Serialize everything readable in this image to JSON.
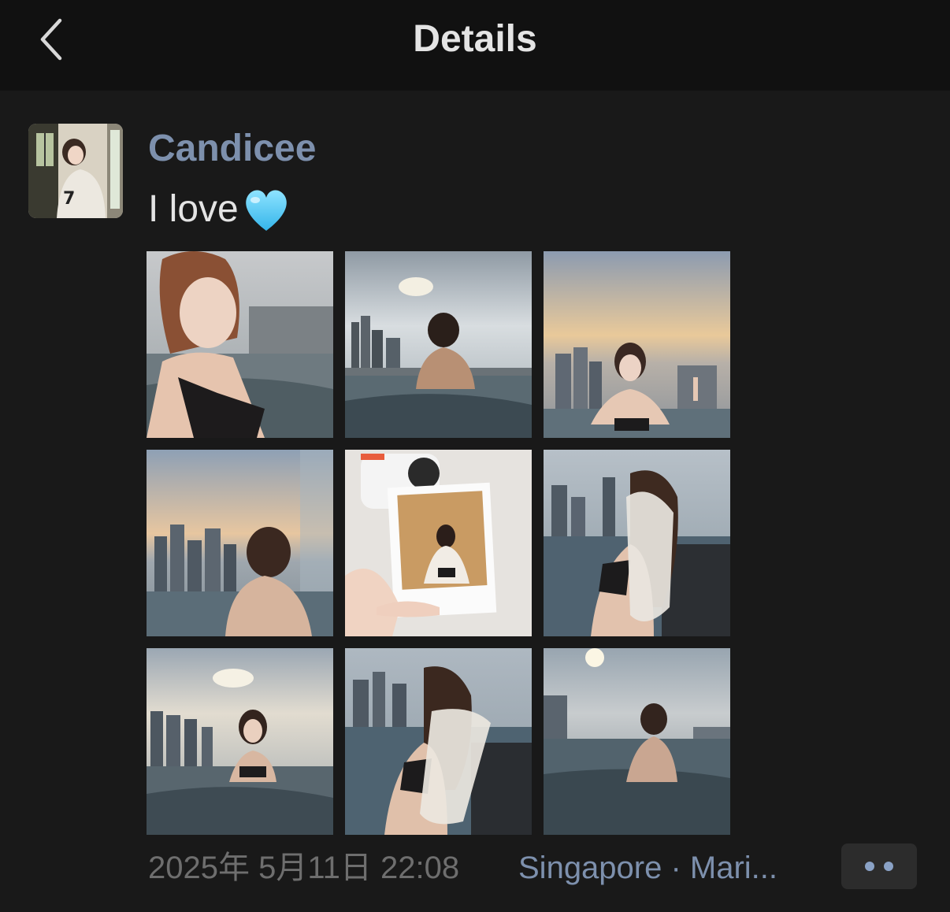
{
  "header": {
    "title": "Details",
    "back_icon": "chevron-left-icon"
  },
  "post": {
    "author": "Candicee",
    "text": "I love",
    "emoji": "light-blue-heart-icon",
    "photos": [
      {
        "scene": "selfie-pool-city"
      },
      {
        "scene": "back-view-pool-sunset"
      },
      {
        "scene": "pool-peace-sign"
      },
      {
        "scene": "back-view-hair-bun"
      },
      {
        "scene": "polaroid-photo"
      },
      {
        "scene": "side-view-cardigan"
      },
      {
        "scene": "in-pool-skyline"
      },
      {
        "scene": "cardigan-pool-edge"
      },
      {
        "scene": "back-view-sun-glare"
      }
    ],
    "timestamp": "2025年 5月11日 22:08",
    "location": "Singapore · Mari...",
    "more_icon": "more-dots-icon"
  },
  "colors": {
    "background": "#191919",
    "header_bg": "#111111",
    "link": "#7d90ad",
    "muted": "#6e6e6e",
    "more_bg": "#2c2c2c"
  }
}
